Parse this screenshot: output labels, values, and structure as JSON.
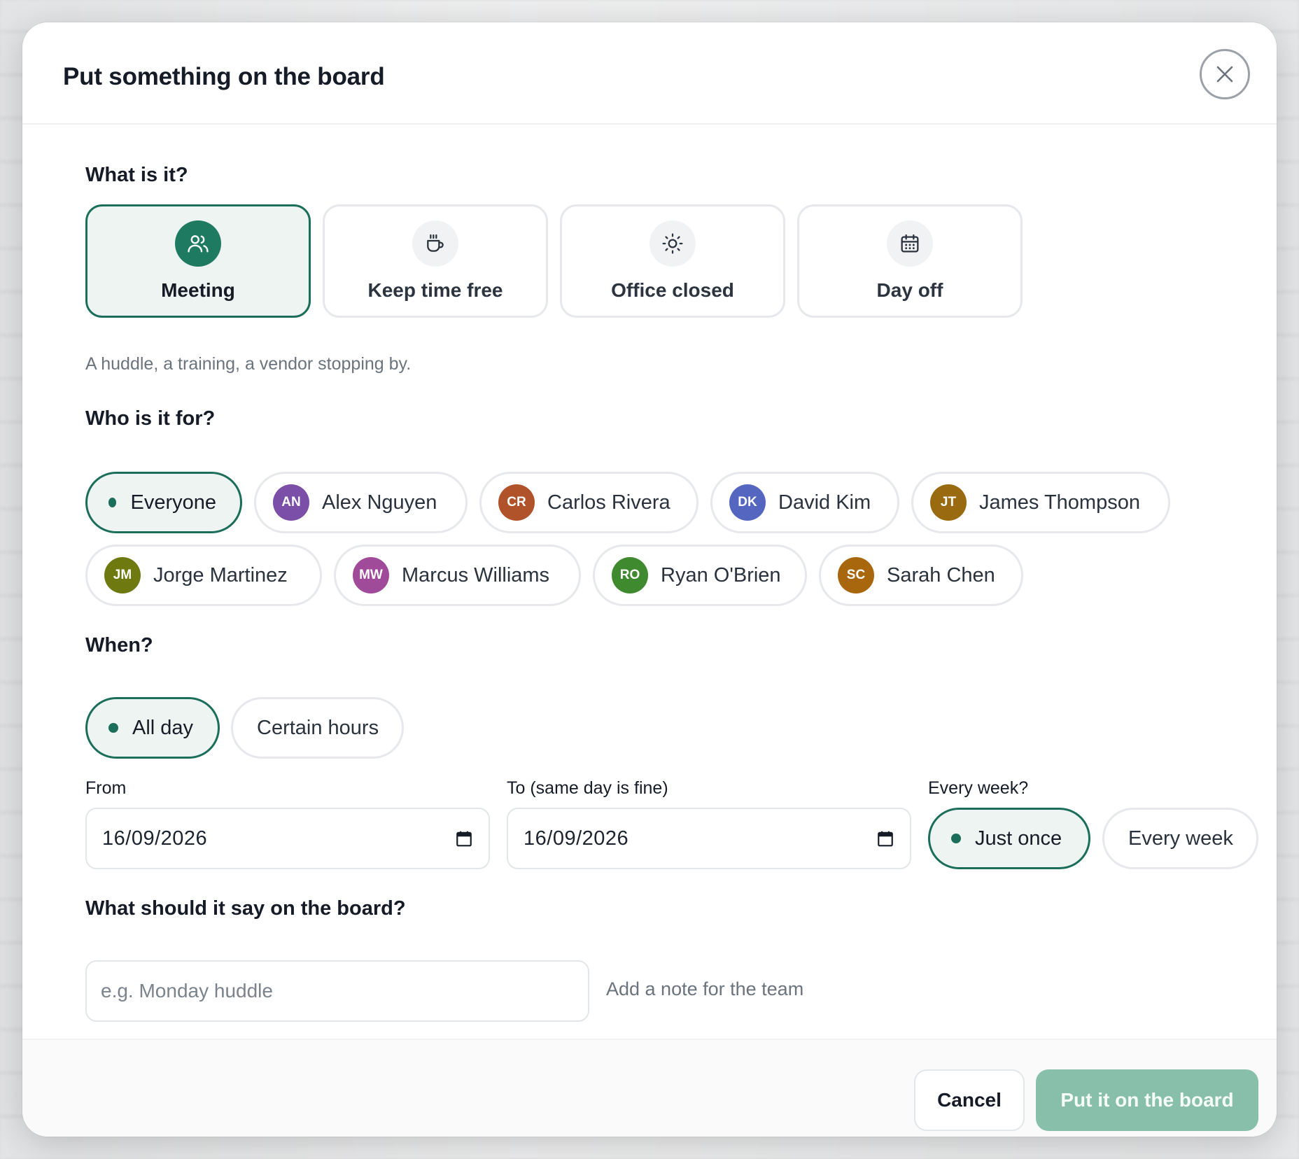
{
  "modal": {
    "title": "Put something on the board",
    "close_icon": "close-icon"
  },
  "what": {
    "label": "What is it?",
    "options": [
      {
        "label": "Meeting",
        "icon": "people-icon",
        "selected": true
      },
      {
        "label": "Keep time free",
        "icon": "coffee-cup-icon",
        "selected": false
      },
      {
        "label": "Office closed",
        "icon": "sun-icon",
        "selected": false
      },
      {
        "label": "Day off",
        "icon": "calendar-icon",
        "selected": false
      }
    ],
    "hint": "A huddle, a training, a vendor stopping by."
  },
  "who": {
    "label": "Who is it for?",
    "everyone": "Everyone",
    "people": [
      {
        "initials": "AN",
        "name": "Alex Nguyen",
        "color": "#7b4fa8"
      },
      {
        "initials": "CR",
        "name": "Carlos Rivera",
        "color": "#b0522a"
      },
      {
        "initials": "DK",
        "name": "David Kim",
        "color": "#5566c0"
      },
      {
        "initials": "JT",
        "name": "James Thompson",
        "color": "#9a6a10"
      },
      {
        "initials": "JM",
        "name": "Jorge Martinez",
        "color": "#6e7a10"
      },
      {
        "initials": "MW",
        "name": "Marcus Williams",
        "color": "#a04a9a"
      },
      {
        "initials": "RO",
        "name": "Ryan O'Brien",
        "color": "#3f8a2e"
      },
      {
        "initials": "SC",
        "name": "Sarah Chen",
        "color": "#a8670c"
      }
    ]
  },
  "when": {
    "label": "When?",
    "all_day": "All day",
    "certain_hours": "Certain hours",
    "from_label": "From",
    "from_value": "16/09/2026",
    "to_label": "To (same day is fine)",
    "to_value": "16/09/2026",
    "repeat_label": "Every week?",
    "just_once": "Just once",
    "every_week": "Every week"
  },
  "board_text": {
    "label": "What should it say on the board?",
    "placeholder": "e.g. Monday huddle",
    "note_link": "Add a note for the team"
  },
  "footer": {
    "cancel": "Cancel",
    "submit": "Put it on the board"
  },
  "colors": {
    "accent": "#1a6e5a",
    "accent_light": "#eef4f1",
    "submit_disabled": "#88bfab"
  }
}
